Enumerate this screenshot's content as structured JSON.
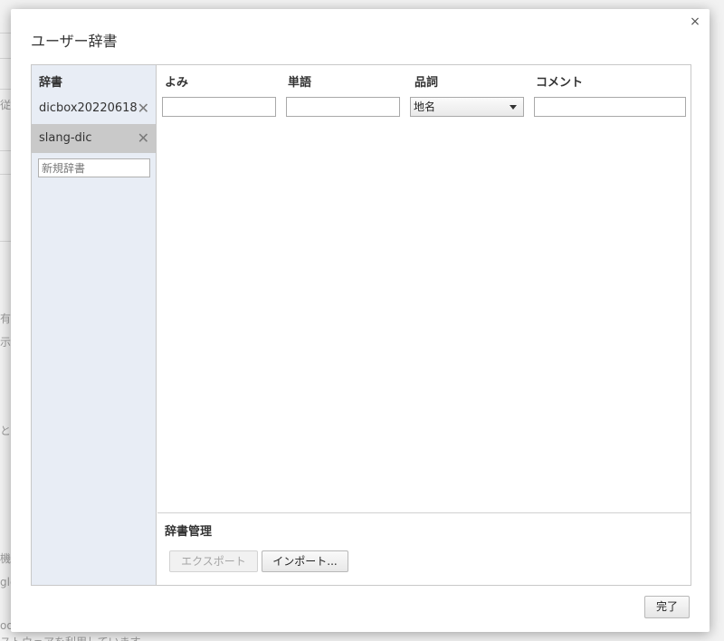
{
  "dialog": {
    "title": "ユーザー辞書",
    "close_glyph": "×",
    "done_label": "完了"
  },
  "sidebar": {
    "header": "辞書",
    "dictionaries": [
      {
        "name": "dicbox20220618",
        "remove_glyph": "✕"
      },
      {
        "name": "slang-dic",
        "remove_glyph": "✕"
      }
    ],
    "new_dictionary_placeholder": "新規辞書"
  },
  "entries": {
    "columns": {
      "reading": "よみ",
      "word": "単語",
      "part_of_speech": "品詞",
      "comment": "コメント"
    },
    "new_row": {
      "reading": "",
      "word": "",
      "part_of_speech": "地名",
      "comment": ""
    }
  },
  "management": {
    "title": "辞書管理",
    "export_label": "エクスポート",
    "import_label": "インポート..."
  },
  "background_fragments": [
    "従",
    "有効",
    "示を",
    "とハ",
    "機能",
    "gle",
    "ooc",
    "ストウェアを利用しています"
  ]
}
